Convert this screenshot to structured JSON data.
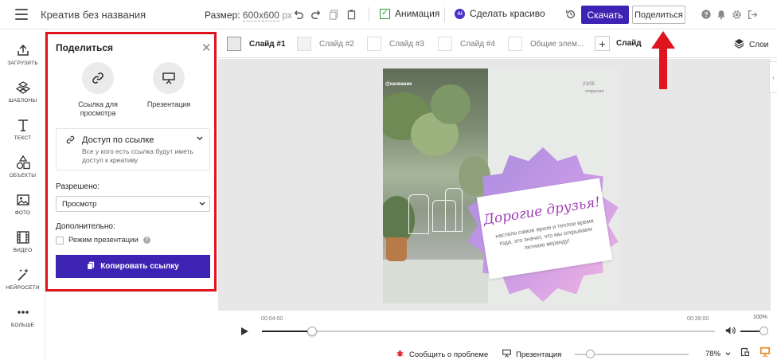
{
  "header": {
    "doc_title": "Креатив без названия",
    "size_label": "Размер:",
    "size_value": "600x600",
    "size_unit": "px",
    "animation_label": "Анимация",
    "ai_badge": "AI",
    "beautify_label": "Сделать красиво",
    "download_label": "Скачать",
    "share_label": "Поделиться"
  },
  "sidebar": {
    "items": [
      {
        "label": "ЗАГРУЗИТЬ",
        "icon": "upload-icon"
      },
      {
        "label": "ШАБЛОНЫ",
        "icon": "templates-icon"
      },
      {
        "label": "ТЕКСТ",
        "icon": "text-icon"
      },
      {
        "label": "ОБЪЕКТЫ",
        "icon": "objects-icon"
      },
      {
        "label": "ФОТО",
        "icon": "photo-icon"
      },
      {
        "label": "ВИДЕО",
        "icon": "video-icon"
      },
      {
        "label": "НЕЙРОСЕТИ",
        "icon": "ai-wand-icon"
      },
      {
        "label": "БОЛЬШЕ",
        "icon": "more-icon"
      }
    ]
  },
  "share_panel": {
    "title": "Поделиться",
    "close": "✕",
    "options": [
      {
        "label": "Ссылка для просмотра",
        "icon": "link-icon"
      },
      {
        "label": "Презентация",
        "icon": "presentation-icon"
      }
    ],
    "access": {
      "title": "Доступ по ссылке",
      "description": "Все у кого есть ссылка будут иметь доступ к креативу"
    },
    "permission_label": "Разрешено:",
    "permission_value": "Просмотр",
    "extra_label": "Дополнительно:",
    "presentation_mode_label": "Режим презентации",
    "help": "?",
    "copy_button": "Копировать ссылку"
  },
  "slides": {
    "tabs": [
      "Слайд #1",
      "Слайд #2",
      "Слайд #3",
      "Слайд #4",
      "Общие элем..."
    ],
    "add_label": "Слайд",
    "layers_label": "Слои"
  },
  "slide_content": {
    "brand": "@название",
    "date": "21/05",
    "date_sub": "открытие",
    "heading": "Дорогие друзья!",
    "body": "настало самое яркое и теплое время года, это значит, что мы открываем летнюю веранду!"
  },
  "timeline": {
    "start_time": "00:04:00",
    "end_time": "00:39:00",
    "volume_pct": "100%",
    "progress": 0.11
  },
  "bottom": {
    "report_label": "Сообщить о проблеме",
    "presentation_label": "Презентация",
    "zoom_value": "78%"
  },
  "colors": {
    "accent": "#3d23b3",
    "highlight": "#e0141e",
    "heading_color": "#9c3fb3"
  }
}
